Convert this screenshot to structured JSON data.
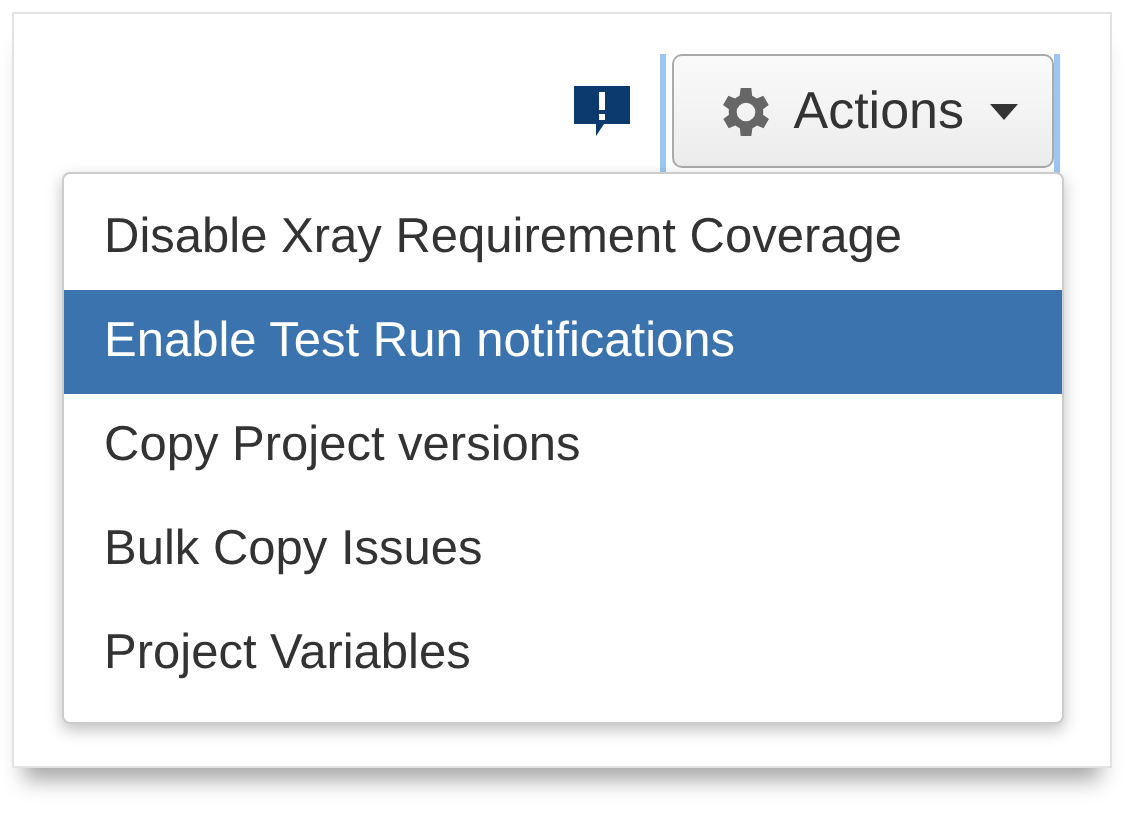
{
  "actions_button": {
    "label": "Actions"
  },
  "menu": {
    "items": [
      {
        "label": "Disable Xray Requirement Coverage",
        "selected": false
      },
      {
        "label": "Enable Test Run notifications",
        "selected": true
      },
      {
        "label": "Copy Project versions",
        "selected": false
      },
      {
        "label": "Bulk Copy Issues",
        "selected": false
      },
      {
        "label": "Project Variables",
        "selected": false
      }
    ]
  }
}
